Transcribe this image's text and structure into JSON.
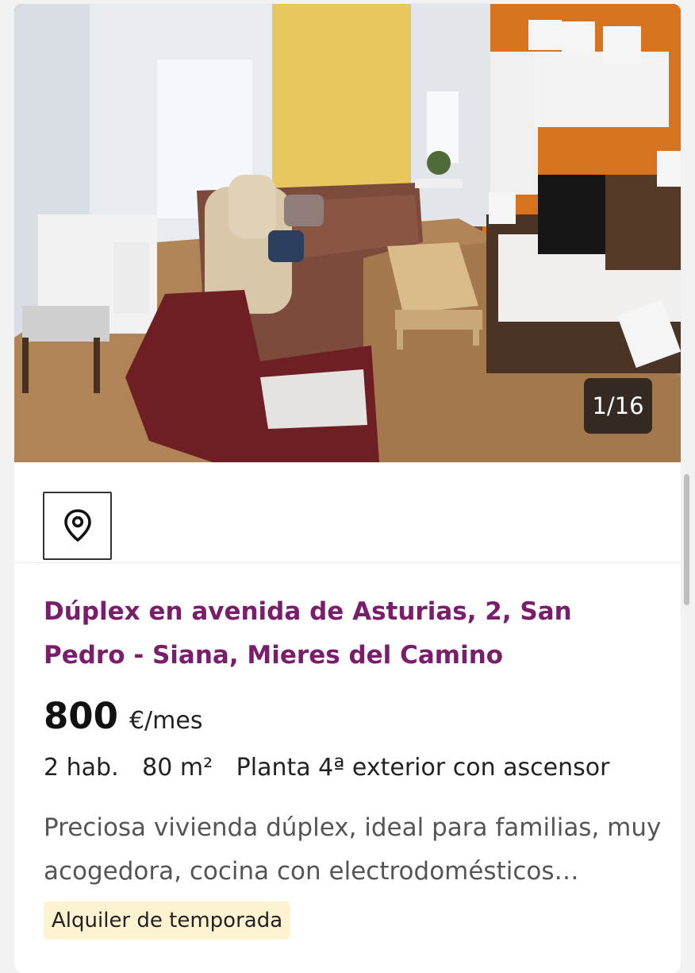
{
  "listing": {
    "photo": {
      "alt": "living room with sofa, coffee table and TV unit",
      "counter": "1/16"
    },
    "map_icon": "location-pin-icon",
    "title": "Dúplex en avenida de Asturias, 2, San Pedro - Siana, Mieres del Camino",
    "price": "800",
    "price_unit": "€/mes",
    "features": [
      "2 hab.",
      "80 m²",
      "Planta 4ª exterior con ascensor"
    ],
    "description": "Preciosa vivienda dúplex, ideal para familias, muy acogedora, cocina con electrodomésticos…",
    "tag": "Alquiler de temporada"
  },
  "colors": {
    "title": "#7a1d6a",
    "tag_background": "#fdf3d0",
    "counter_background": "#141414"
  }
}
